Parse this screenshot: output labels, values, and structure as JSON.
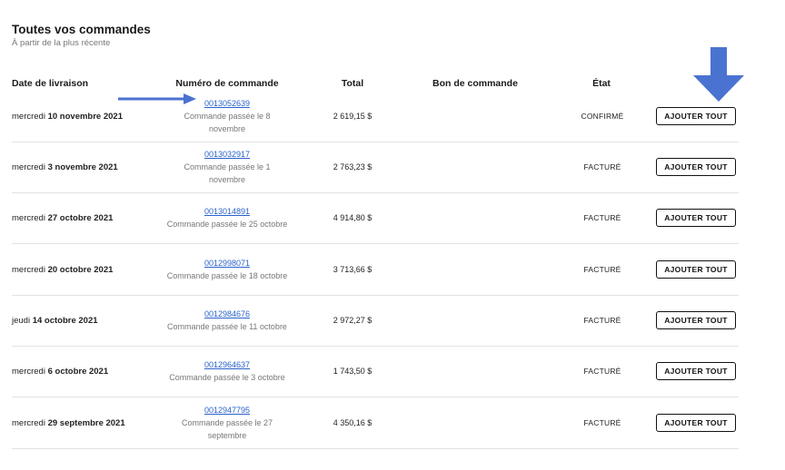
{
  "page": {
    "title": "Toutes vos commandes",
    "subtitle": "À partir de la plus récente"
  },
  "columns": {
    "date": "Date de livraison",
    "number": "Numéro de commande",
    "total": "Total",
    "po": "Bon de commande",
    "state": "État"
  },
  "orders": [
    {
      "day": "mercredi",
      "date": "10 novembre 2021",
      "number": "0013052639",
      "placed_1": "Commande passée le 8",
      "placed_2": "novembre",
      "total": "2 619,15 $",
      "state": "CONFIRMÉ",
      "button": "AJOUTER TOUT"
    },
    {
      "day": "mercredi",
      "date": "3 novembre 2021",
      "number": "0013032917",
      "placed_1": "Commande passée le 1",
      "placed_2": "novembre",
      "total": "2 763,23 $",
      "state": "FACTURÉ",
      "button": "AJOUTER TOUT"
    },
    {
      "day": "mercredi",
      "date": "27 octobre 2021",
      "number": "0013014891",
      "placed_1": "Commande passée le 25 octobre",
      "placed_2": "",
      "total": "4 914,80 $",
      "state": "FACTURÉ",
      "button": "AJOUTER TOUT"
    },
    {
      "day": "mercredi",
      "date": "20 octobre 2021",
      "number": "0012998071",
      "placed_1": "Commande passée le 18 octobre",
      "placed_2": "",
      "total": "3 713,66 $",
      "state": "FACTURÉ",
      "button": "AJOUTER TOUT"
    },
    {
      "day": "jeudi",
      "date": "14 octobre 2021",
      "number": "0012984676",
      "placed_1": "Commande passée le 11 octobre",
      "placed_2": "",
      "total": "2 972,27 $",
      "state": "FACTURÉ",
      "button": "AJOUTER TOUT"
    },
    {
      "day": "mercredi",
      "date": "6 octobre 2021",
      "number": "0012964637",
      "placed_1": "Commande passée le 3 octobre",
      "placed_2": "",
      "total": "1 743,50 $",
      "state": "FACTURÉ",
      "button": "AJOUTER TOUT"
    },
    {
      "day": "mercredi",
      "date": "29 septembre 2021",
      "number": "0012947795",
      "placed_1": "Commande passée le 27",
      "placed_2": "septembre",
      "total": "4 350,16 $",
      "state": "FACTURÉ",
      "button": "AJOUTER TOUT"
    }
  ],
  "colors": {
    "link": "#2a62c9",
    "annotation_arrow": "#4a72d0"
  },
  "annotations": {
    "right_arrow_icon": "arrow-right-icon",
    "down_arrow_icon": "arrow-down-icon"
  }
}
